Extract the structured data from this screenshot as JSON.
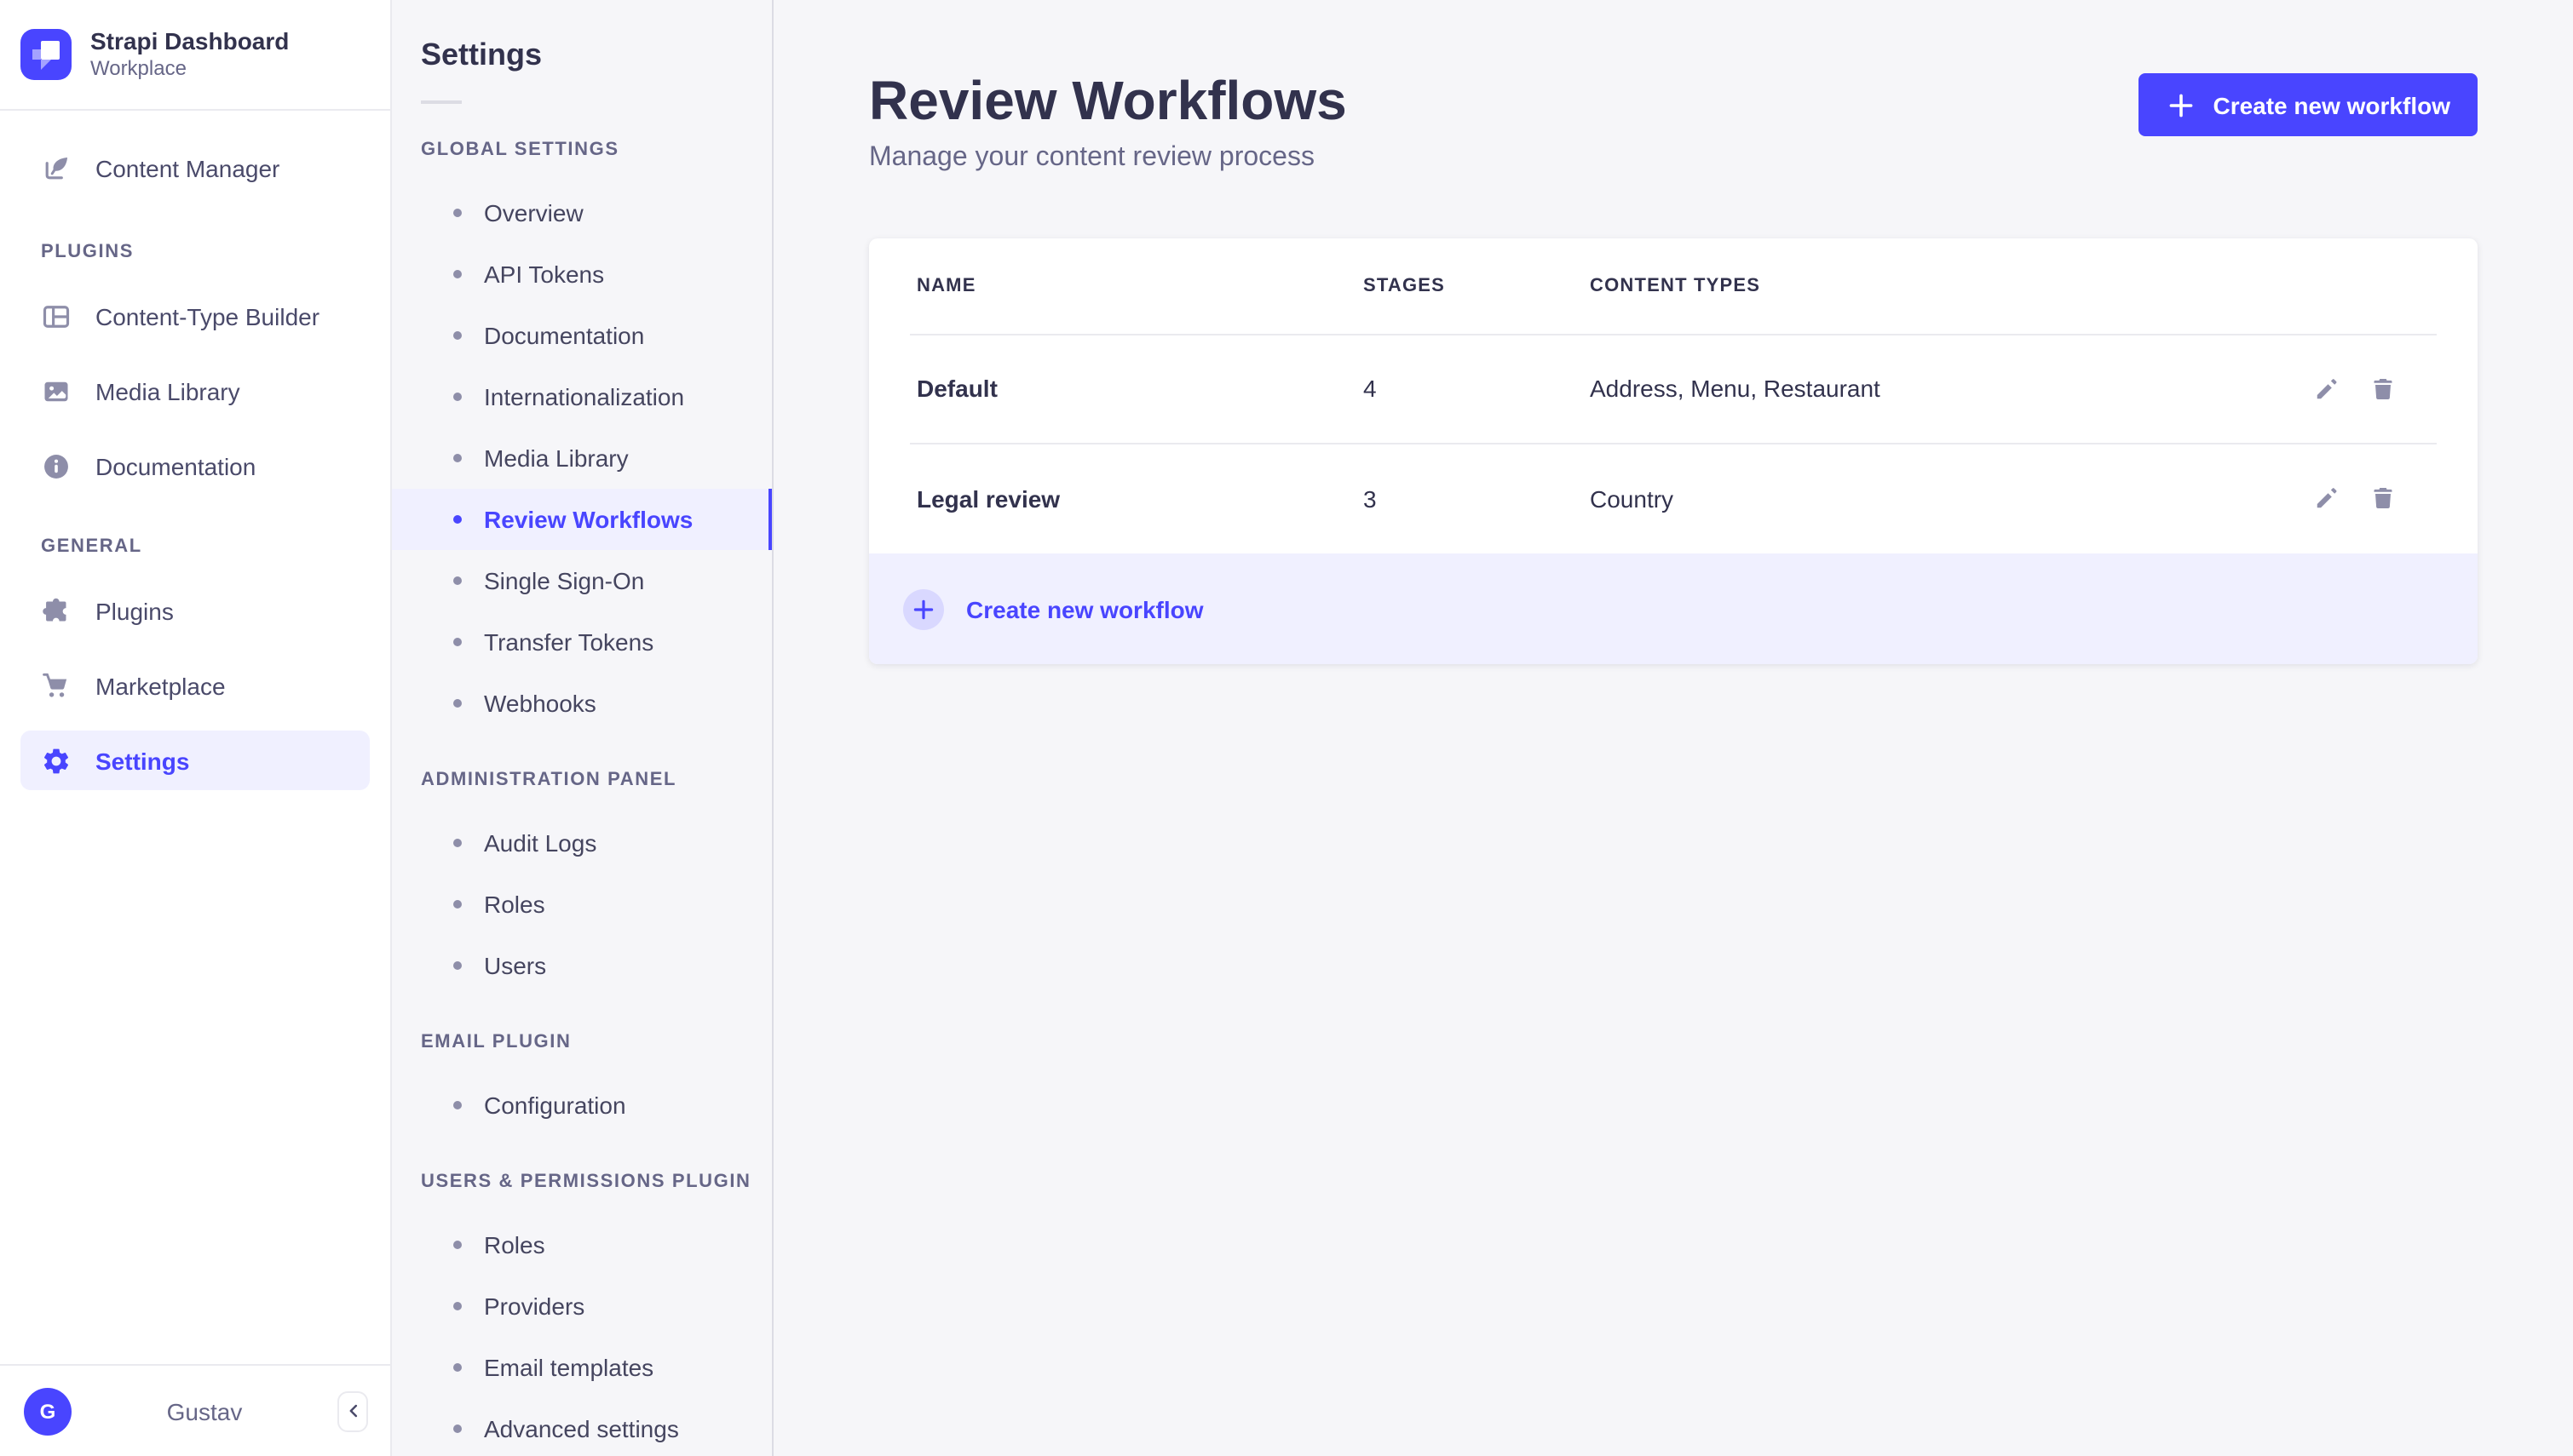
{
  "colors": {
    "primary": "#4945ff",
    "primary_light": "#f0f0ff",
    "primary_soft": "#d9d8ff",
    "background": "#f6f6f9",
    "text_dark": "#32324d",
    "text_muted": "#666687"
  },
  "icons": {
    "logo": "strapi-logo",
    "content_manager": "feather-icon",
    "content_type_builder": "layout-icon",
    "media_library": "image-icon",
    "documentation": "info-circle-icon",
    "plugins": "puzzle-icon",
    "marketplace": "cart-icon",
    "settings": "gear-icon",
    "row_edit": "pencil-icon",
    "row_delete": "trash-icon",
    "create": "plus-icon",
    "collapse": "chevron-left-icon"
  },
  "brand": {
    "title": "Strapi Dashboard",
    "subtitle": "Workplace"
  },
  "sidebar": {
    "top_item": {
      "label": "Content Manager"
    },
    "sections": [
      {
        "label": "PLUGINS",
        "items": [
          {
            "label": "Content-Type Builder"
          },
          {
            "label": "Media Library"
          },
          {
            "label": "Documentation"
          }
        ]
      },
      {
        "label": "GENERAL",
        "items": [
          {
            "label": "Plugins"
          },
          {
            "label": "Marketplace"
          },
          {
            "label": "Settings"
          }
        ]
      }
    ],
    "active_item": "Settings",
    "user": {
      "name": "Gustav",
      "initial": "G"
    }
  },
  "subnav": {
    "title": "Settings",
    "active_item": "Review Workflows",
    "sections": [
      {
        "label": "GLOBAL SETTINGS",
        "items": [
          "Overview",
          "API Tokens",
          "Documentation",
          "Internationalization",
          "Media Library",
          "Review Workflows",
          "Single Sign-On",
          "Transfer Tokens",
          "Webhooks"
        ]
      },
      {
        "label": "ADMINISTRATION PANEL",
        "items": [
          "Audit Logs",
          "Roles",
          "Users"
        ]
      },
      {
        "label": "EMAIL PLUGIN",
        "items": [
          "Configuration"
        ]
      },
      {
        "label": "USERS & PERMISSIONS PLUGIN",
        "items": [
          "Roles",
          "Providers",
          "Email templates",
          "Advanced settings"
        ]
      }
    ]
  },
  "main": {
    "title": "Review Workflows",
    "subtitle": "Manage your content review process",
    "create_button_label": "Create new workflow",
    "table": {
      "columns": [
        "NAME",
        "STAGES",
        "CONTENT TYPES"
      ],
      "rows": [
        {
          "name": "Default",
          "stages": "4",
          "content_types": "Address, Menu, Restaurant"
        },
        {
          "name": "Legal review",
          "stages": "3",
          "content_types": "Country"
        }
      ],
      "footer_action_label": "Create new workflow"
    }
  }
}
